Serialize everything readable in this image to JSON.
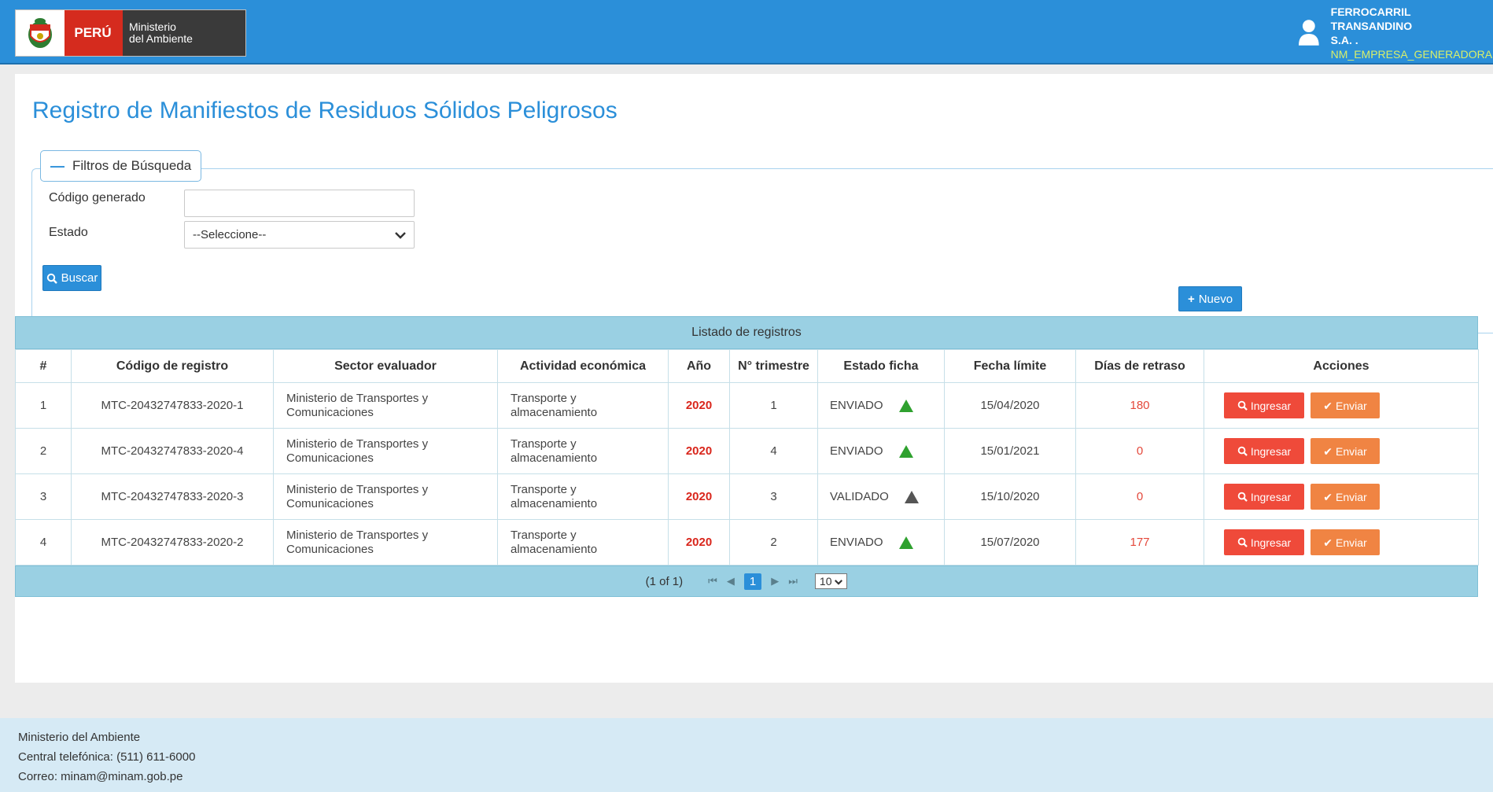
{
  "header": {
    "peru_label": "PERÚ",
    "ministry_line1": "Ministerio",
    "ministry_line2": "del Ambiente",
    "user_name_line1": "FERROCARRIL TRANSANDINO",
    "user_name_line2": "S.A. .",
    "user_role": "NM_EMPRESA_GENERADORA"
  },
  "page": {
    "title": "Registro de Manifiestos de Residuos Sólidos Peligrosos"
  },
  "filters": {
    "legend": "Filtros de Búsqueda",
    "code_label": "Código generado",
    "code_value": "",
    "status_label": "Estado",
    "status_selected": "--Seleccione--",
    "search_button": "Buscar"
  },
  "actions": {
    "new_button": "Nuevo"
  },
  "table": {
    "caption": "Listado de registros",
    "headers": [
      "#",
      "Código de registro",
      "Sector evaluador",
      "Actividad económica",
      "Año",
      "N° trimestre",
      "Estado ficha",
      "Fecha límite",
      "Días de retraso",
      "Acciones"
    ],
    "rows": [
      {
        "num": "1",
        "code": "MTC-20432747833-2020-1",
        "sector_line1": "Ministerio de Transportes y",
        "sector_line2": "Comunicaciones",
        "activity_line1": "Transporte y",
        "activity_line2": "almacenamiento",
        "year": "2020",
        "quarter": "1",
        "status": "ENVIADO",
        "deadline": "15/04/2020",
        "delay": "180",
        "btn_ingresar": "Ingresar",
        "btn_enviar": "Enviar"
      },
      {
        "num": "2",
        "code": "MTC-20432747833-2020-4",
        "sector_line1": "Ministerio de Transportes y",
        "sector_line2": "Comunicaciones",
        "activity_line1": "Transporte y",
        "activity_line2": "almacenamiento",
        "year": "2020",
        "quarter": "4",
        "status": "ENVIADO",
        "deadline": "15/01/2021",
        "delay": "0",
        "btn_ingresar": "Ingresar",
        "btn_enviar": "Enviar"
      },
      {
        "num": "3",
        "code": "MTC-20432747833-2020-3",
        "sector_line1": "Ministerio de Transportes y",
        "sector_line2": "Comunicaciones",
        "activity_line1": "Transporte y",
        "activity_line2": "almacenamiento",
        "year": "2020",
        "quarter": "3",
        "status": "VALIDADO",
        "deadline": "15/10/2020",
        "delay": "0",
        "btn_ingresar": "Ingresar",
        "btn_enviar": "Enviar"
      },
      {
        "num": "4",
        "code": "MTC-20432747833-2020-2",
        "sector_line1": "Ministerio de Transportes y",
        "sector_line2": "Comunicaciones",
        "activity_line1": "Transporte y",
        "activity_line2": "almacenamiento",
        "year": "2020",
        "quarter": "2",
        "status": "ENVIADO",
        "deadline": "15/07/2020",
        "delay": "177",
        "btn_ingresar": "Ingresar",
        "btn_enviar": "Enviar"
      }
    ],
    "pager_info": "(1 of 1)",
    "current_page": "1",
    "rows_per_page": "10"
  },
  "footer": {
    "line1": "Ministerio del Ambiente",
    "line2": "Central telefónica: (511) 611-6000",
    "line3": "Correo: minam@minam.gob.pe"
  },
  "colors": {
    "header_bg": "#2b8fd9",
    "title": "#2b8fd9",
    "btn_ingresar": "#ef4a3a",
    "btn_enviar": "#f08443",
    "status_sent": "#2fa12f",
    "status_validated": "#555555"
  },
  "icons": {
    "logo": "peru-coat-of-arms-icon",
    "user": "user-icon",
    "collapse": "minus-icon",
    "search": "search-icon",
    "add": "plus-icon",
    "send": "check-icon",
    "status_sent": "green-triangle-icon",
    "status_validated": "grey-triangle-icon"
  }
}
